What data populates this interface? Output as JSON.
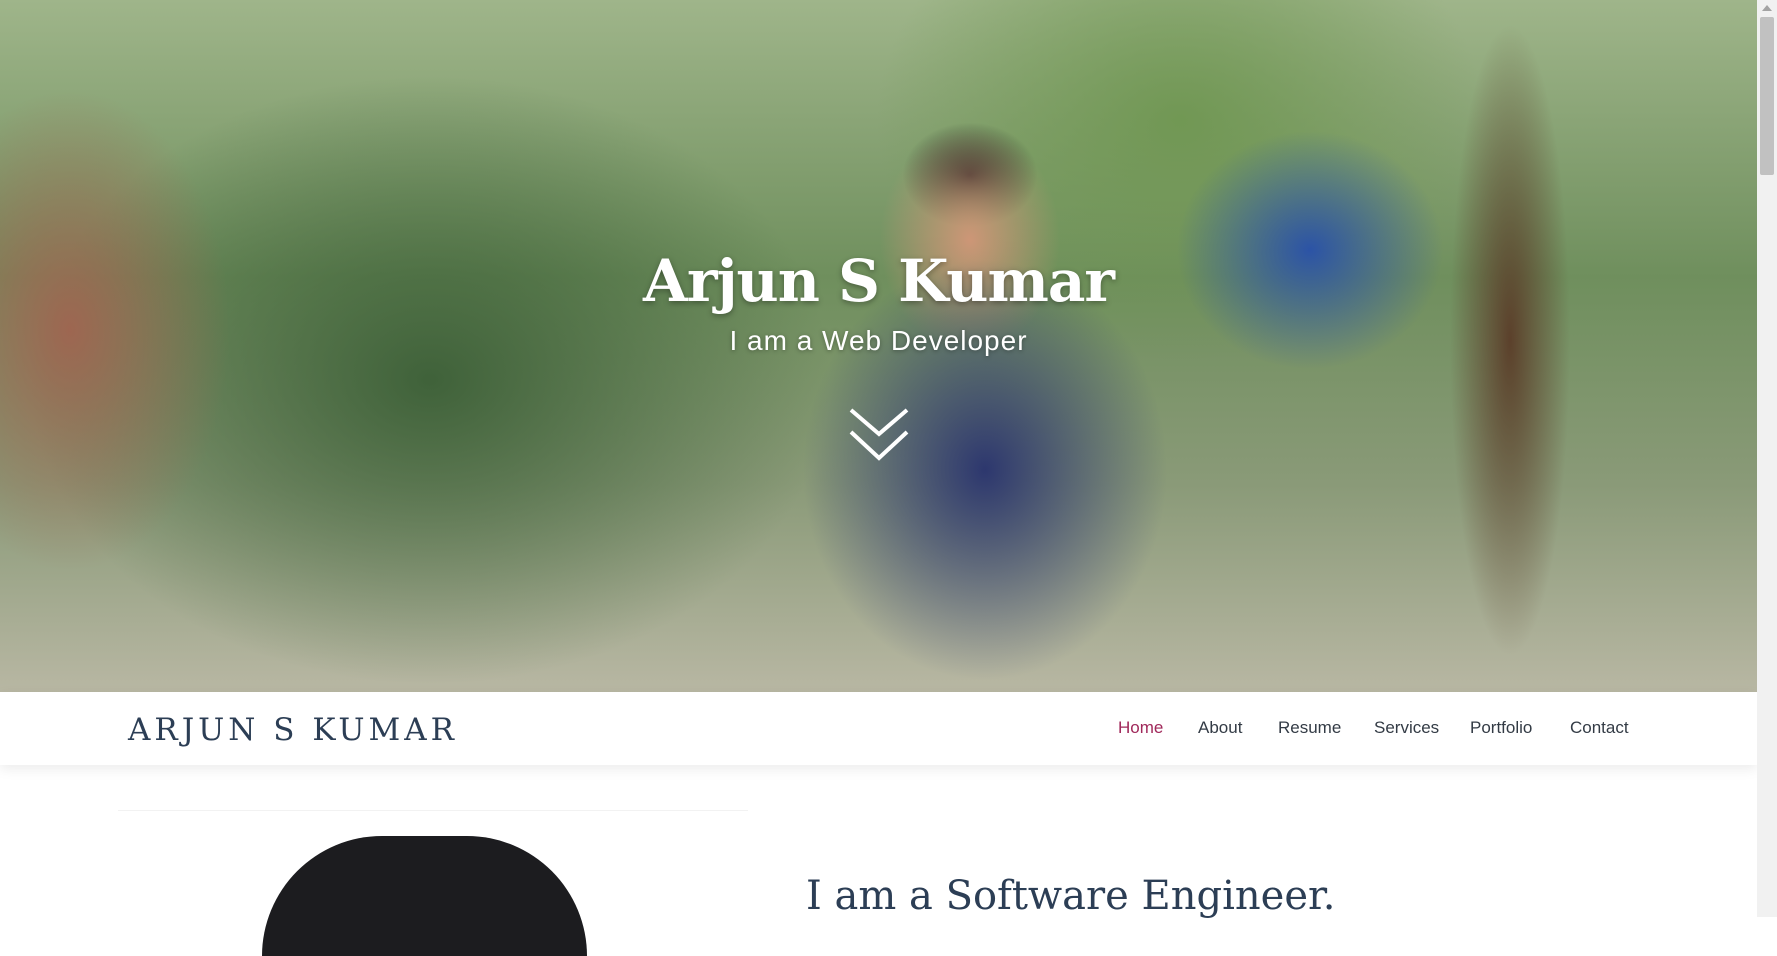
{
  "hero": {
    "title": "Arjun S Kumar",
    "subtitle": "I am a Web Developer"
  },
  "navbar": {
    "brand": "ARJUN S KUMAR",
    "items": [
      {
        "label": "Home",
        "active": true
      },
      {
        "label": "About",
        "active": false
      },
      {
        "label": "Resume",
        "active": false
      },
      {
        "label": "Services",
        "active": false
      },
      {
        "label": "Portfolio",
        "active": false
      },
      {
        "label": "Contact",
        "active": false
      }
    ]
  },
  "about": {
    "heading": "I am a Software Engineer."
  },
  "colors": {
    "accent": "#a0285a",
    "heading": "#2c3e55",
    "nav_text": "#333b45"
  },
  "icons": {
    "scroll_down": "double-chevron-down-icon"
  }
}
